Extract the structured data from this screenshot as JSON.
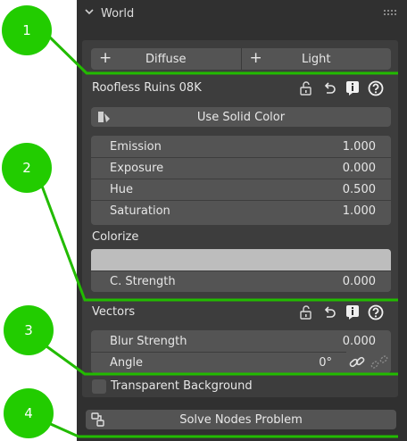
{
  "panel": {
    "title": "World",
    "colors": {
      "background": "#303030",
      "inner": "#3d3d3d",
      "field": "#545454",
      "callout": "#22cc00"
    }
  },
  "buttons": {
    "diffuse": "Diffuse",
    "light": "Light",
    "use_solid_color": "Use Solid Color",
    "solve_nodes": "Solve Nodes Problem"
  },
  "hdri_name": "Roofless Ruins 08K",
  "fields": [
    {
      "label": "Emission",
      "value": "1.000"
    },
    {
      "label": "Exposure",
      "value": "0.000"
    },
    {
      "label": "Hue",
      "value": "0.500"
    },
    {
      "label": "Saturation",
      "value": "1.000"
    }
  ],
  "colorize": {
    "label": "Colorize",
    "swatch_color": "#bdbdbd",
    "strength_label": "C. Strength",
    "strength_value": "0.000"
  },
  "vectors": {
    "label": "Vectors",
    "blur_label": "Blur Strength",
    "blur_value": "0.000",
    "angle_label": "Angle",
    "angle_value": "0°"
  },
  "transparent_background": {
    "label": "Transparent Background",
    "checked": false
  },
  "callouts": [
    "1",
    "2",
    "3",
    "4"
  ]
}
